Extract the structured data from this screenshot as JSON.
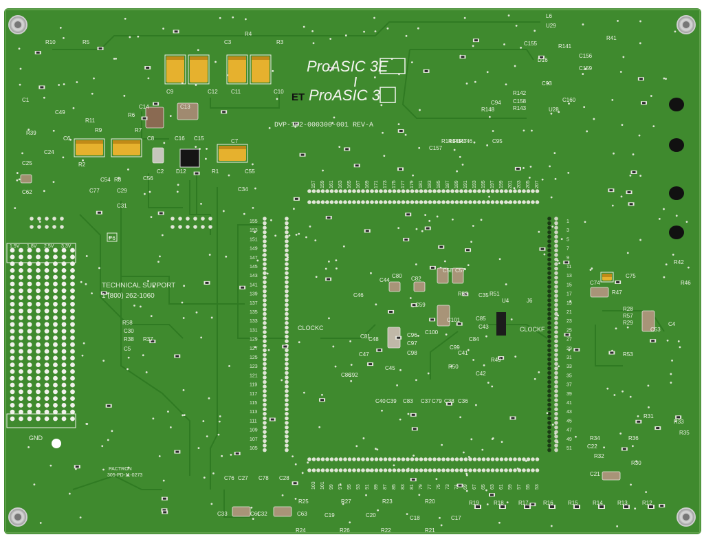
{
  "board": {
    "logo_primary": "ProASIC 3E",
    "logo_secondary": "ProASIC 3",
    "logo_et": "ET",
    "part_number": "DVP-102-000300-001 REV-A",
    "support_title": "TECHNICAL SUPPORT",
    "support_phone": "1 (800) 262-1060",
    "vendor": "PACTRON",
    "vendor_code": "305-PD-11-0273",
    "gnd_label": "GND",
    "clock_left": "CLOCKC",
    "clock_right": "CLOCKF",
    "p6_label": "P6",
    "voltage_labels": [
      "1.5V",
      "1.8V",
      "2.5V",
      "3.3V"
    ]
  },
  "header_numbers": {
    "top_row": [
      "157",
      "159",
      "161",
      "163",
      "165",
      "167",
      "169",
      "171",
      "173",
      "175",
      "177",
      "179",
      "181",
      "183",
      "185",
      "187",
      "189",
      "191",
      "193",
      "195",
      "197",
      "199",
      "201",
      "203",
      "205",
      "207"
    ],
    "left_col": [
      "155",
      "153",
      "151",
      "149",
      "147",
      "145",
      "143",
      "141",
      "139",
      "137",
      "135",
      "133",
      "131",
      "129",
      "127",
      "125",
      "123",
      "121",
      "119",
      "117",
      "115",
      "113",
      "111",
      "109",
      "107",
      "105"
    ],
    "right_col": [
      "1",
      "3",
      "5",
      "7",
      "9",
      "11",
      "13",
      "15",
      "17",
      "19",
      "21",
      "23",
      "25",
      "27",
      "29",
      "31",
      "33",
      "35",
      "37",
      "39",
      "41",
      "43",
      "45",
      "47",
      "49",
      "51"
    ],
    "bottom_row": [
      "103",
      "101",
      "99",
      "97",
      "95",
      "93",
      "91",
      "89",
      "87",
      "85",
      "83",
      "81",
      "79",
      "77",
      "75",
      "73",
      "71",
      "69",
      "67",
      "65",
      "63",
      "61",
      "59",
      "57",
      "55",
      "53"
    ]
  },
  "component_labels": [
    {
      "t": "R10"
    },
    {
      "t": "R5"
    },
    {
      "t": "R4"
    },
    {
      "t": "R3"
    },
    {
      "t": "C3"
    },
    {
      "t": "C1"
    },
    {
      "t": "C49"
    },
    {
      "t": "R39"
    },
    {
      "t": "C24"
    },
    {
      "t": "C25"
    },
    {
      "t": "C62"
    },
    {
      "t": "C9"
    },
    {
      "t": "C12"
    },
    {
      "t": "C11"
    },
    {
      "t": "C10"
    },
    {
      "t": "C14"
    },
    {
      "t": "C13"
    },
    {
      "t": "R11"
    },
    {
      "t": "R6"
    },
    {
      "t": "R9"
    },
    {
      "t": "R7"
    },
    {
      "t": "C6"
    },
    {
      "t": "C8"
    },
    {
      "t": "C16"
    },
    {
      "t": "C15"
    },
    {
      "t": "C7"
    },
    {
      "t": "R2"
    },
    {
      "t": "C2"
    },
    {
      "t": "D12"
    },
    {
      "t": "R1"
    },
    {
      "t": "C55"
    },
    {
      "t": "C54"
    },
    {
      "t": "C56"
    },
    {
      "t": "R8"
    },
    {
      "t": "C29"
    },
    {
      "t": "C31"
    },
    {
      "t": "C77"
    },
    {
      "t": "C34"
    },
    {
      "t": "L6"
    },
    {
      "t": "U29"
    },
    {
      "t": "R41"
    },
    {
      "t": "C155"
    },
    {
      "t": "R141"
    },
    {
      "t": "D16"
    },
    {
      "t": "C156"
    },
    {
      "t": "C159"
    },
    {
      "t": "C93"
    },
    {
      "t": "U28"
    },
    {
      "t": "R142"
    },
    {
      "t": "C158"
    },
    {
      "t": "R143"
    },
    {
      "t": "C160"
    },
    {
      "t": "C94"
    },
    {
      "t": "R148"
    },
    {
      "t": "C157"
    },
    {
      "t": "R144"
    },
    {
      "t": "R145"
    },
    {
      "t": "R147"
    },
    {
      "t": "R146"
    },
    {
      "t": "C95"
    },
    {
      "t": "C44"
    },
    {
      "t": "C80"
    },
    {
      "t": "C58"
    },
    {
      "t": "C57"
    },
    {
      "t": "C82"
    },
    {
      "t": "C46"
    },
    {
      "t": "C59"
    },
    {
      "t": "R52"
    },
    {
      "t": "C35"
    },
    {
      "t": "R51"
    },
    {
      "t": "U4"
    },
    {
      "t": "J6"
    },
    {
      "t": "C101"
    },
    {
      "t": "C43"
    },
    {
      "t": "C85"
    },
    {
      "t": "C100"
    },
    {
      "t": "C96"
    },
    {
      "t": "C97"
    },
    {
      "t": "C98"
    },
    {
      "t": "C81"
    },
    {
      "t": "C48"
    },
    {
      "t": "C99"
    },
    {
      "t": "C84"
    },
    {
      "t": "C47"
    },
    {
      "t": "C41"
    },
    {
      "t": "R49"
    },
    {
      "t": "C86"
    },
    {
      "t": "C92"
    },
    {
      "t": "C45"
    },
    {
      "t": "R50"
    },
    {
      "t": "C42"
    },
    {
      "t": "C40"
    },
    {
      "t": "C39"
    },
    {
      "t": "C83"
    },
    {
      "t": "C37"
    },
    {
      "t": "C79"
    },
    {
      "t": "C38"
    },
    {
      "t": "C36"
    },
    {
      "t": "R58"
    },
    {
      "t": "C30"
    },
    {
      "t": "R38"
    },
    {
      "t": "R37"
    },
    {
      "t": "C5"
    },
    {
      "t": "R42"
    },
    {
      "t": "C75"
    },
    {
      "t": "C74"
    },
    {
      "t": "R47"
    },
    {
      "t": "R46"
    },
    {
      "t": "R28"
    },
    {
      "t": "R57"
    },
    {
      "t": "R29"
    },
    {
      "t": "C53"
    },
    {
      "t": "C4"
    },
    {
      "t": "R53"
    },
    {
      "t": "R31"
    },
    {
      "t": "R33"
    },
    {
      "t": "R34"
    },
    {
      "t": "R36"
    },
    {
      "t": "C22"
    },
    {
      "t": "R35"
    },
    {
      "t": "R32"
    },
    {
      "t": "R30"
    },
    {
      "t": "C21"
    },
    {
      "t": "C76"
    },
    {
      "t": "C27"
    },
    {
      "t": "C78"
    },
    {
      "t": "C28"
    },
    {
      "t": "C33"
    },
    {
      "t": "C61"
    },
    {
      "t": "C32"
    },
    {
      "t": "C63"
    },
    {
      "t": "R25"
    },
    {
      "t": "C19"
    },
    {
      "t": "R27"
    },
    {
      "t": "C20"
    },
    {
      "t": "R23"
    },
    {
      "t": "C18"
    },
    {
      "t": "R20"
    },
    {
      "t": "C17"
    },
    {
      "t": "R24"
    },
    {
      "t": "R26"
    },
    {
      "t": "R22"
    },
    {
      "t": "R21"
    },
    {
      "t": "R19"
    },
    {
      "t": "R18"
    },
    {
      "t": "R17"
    },
    {
      "t": "R16"
    },
    {
      "t": "R15"
    },
    {
      "t": "R14"
    },
    {
      "t": "R13"
    },
    {
      "t": "R12"
    }
  ]
}
